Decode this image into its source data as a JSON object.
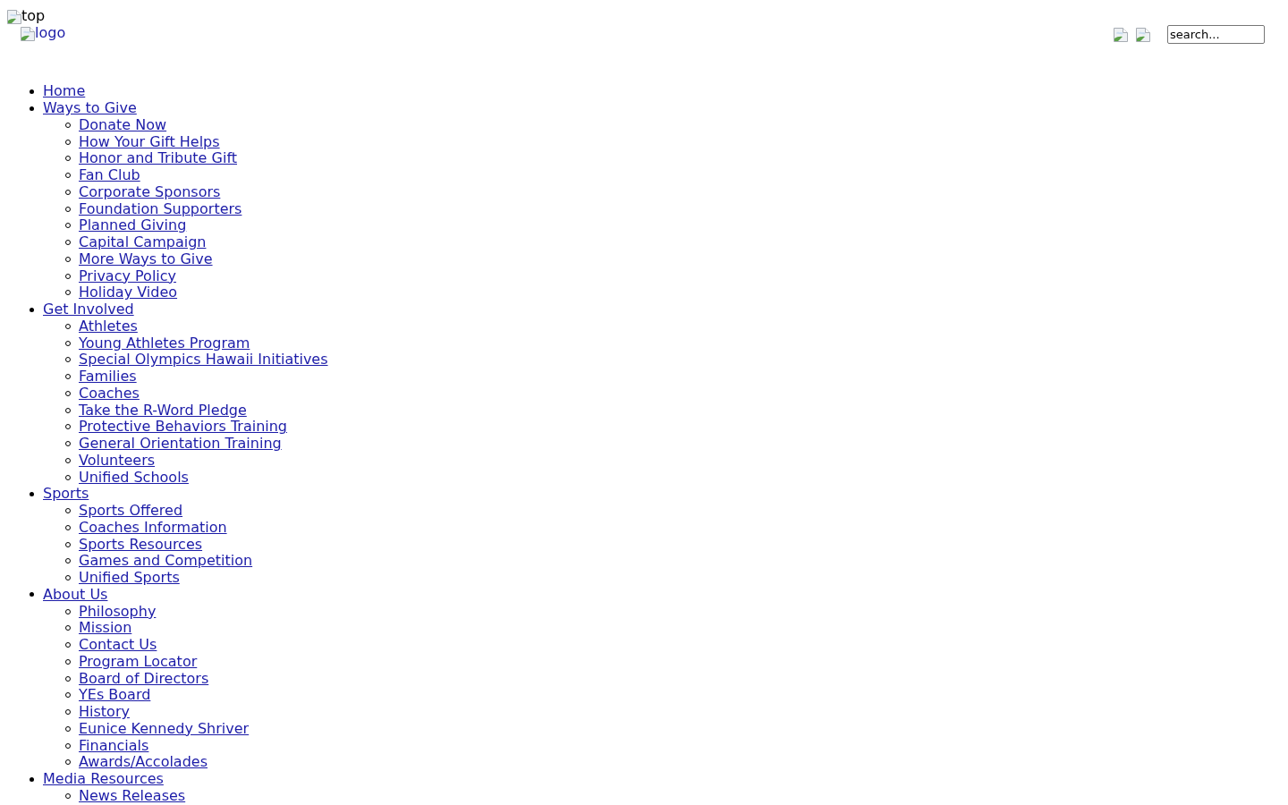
{
  "header": {
    "top_image": {
      "alt": "top"
    },
    "logo": {
      "alt": "logo"
    },
    "search": {
      "value": "search..."
    }
  },
  "nav": [
    {
      "label": "Home"
    },
    {
      "label": "Ways to Give",
      "children": [
        {
          "label": "Donate Now"
        },
        {
          "label": "How Your Gift Helps"
        },
        {
          "label": "Honor and Tribute Gift"
        },
        {
          "label": "Fan Club"
        },
        {
          "label": "Corporate Sponsors"
        },
        {
          "label": "Foundation Supporters"
        },
        {
          "label": "Planned Giving"
        },
        {
          "label": "Capital Campaign"
        },
        {
          "label": "More Ways to Give"
        },
        {
          "label": "Privacy Policy"
        },
        {
          "label": "Holiday Video"
        }
      ]
    },
    {
      "label": "Get Involved",
      "children": [
        {
          "label": "Athletes"
        },
        {
          "label": "Young Athletes Program"
        },
        {
          "label": "Special Olympics Hawaii Initiatives"
        },
        {
          "label": "Families"
        },
        {
          "label": "Coaches"
        },
        {
          "label": "Take the R-Word Pledge"
        },
        {
          "label": "Protective Behaviors Training"
        },
        {
          "label": "General Orientation Training"
        },
        {
          "label": "Volunteers"
        },
        {
          "label": "Unified Schools"
        }
      ]
    },
    {
      "label": "Sports",
      "children": [
        {
          "label": "Sports Offered"
        },
        {
          "label": "Coaches Information"
        },
        {
          "label": "Sports Resources"
        },
        {
          "label": "Games and Competition"
        },
        {
          "label": "Unified Sports"
        }
      ]
    },
    {
      "label": "About Us",
      "children": [
        {
          "label": "Philosophy"
        },
        {
          "label": "Mission"
        },
        {
          "label": "Contact Us"
        },
        {
          "label": "Program Locator"
        },
        {
          "label": "Board of Directors"
        },
        {
          "label": "YEs Board"
        },
        {
          "label": "History"
        },
        {
          "label": "Eunice Kennedy Shriver"
        },
        {
          "label": "Financials"
        },
        {
          "label": "Awards/Accolades"
        }
      ]
    },
    {
      "label": "Media Resources",
      "children": [
        {
          "label": "News Releases"
        }
      ]
    }
  ]
}
